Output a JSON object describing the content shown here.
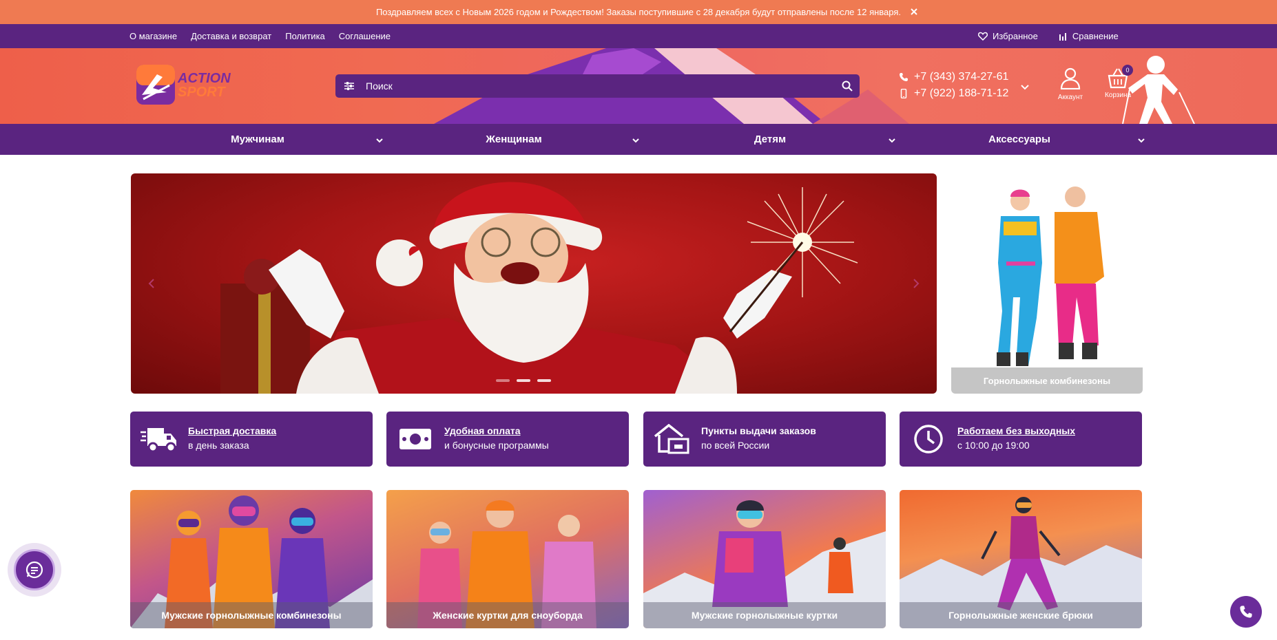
{
  "announcement": {
    "text": "Поздравляем всех с Новым 2026 годом и Рождеством! Заказы поступившие с 28 декабря будут отправлены после 12 января.",
    "close_icon": "close-icon"
  },
  "topnav": {
    "links": [
      "О магазине",
      "Доставка и возврат",
      "Политика",
      "Соглашение"
    ],
    "favorites_label": "Избранное",
    "compare_label": "Сравнение"
  },
  "header": {
    "logo_text_1": "ACTION",
    "logo_text_2": "SPORT",
    "search_placeholder": "Поиск",
    "phones": [
      "+7 (343) 374-27-61",
      "+7 (922) 188-71-12"
    ],
    "account_label": "Аккаунт",
    "cart_label": "Корзина",
    "cart_count": "0"
  },
  "categories": [
    {
      "label": "Мужчинам"
    },
    {
      "label": "Женщинам"
    },
    {
      "label": "Детям"
    },
    {
      "label": "Аксессуары"
    }
  ],
  "hero": {
    "slide_count": 3,
    "active_slide": 1
  },
  "side_banner": {
    "caption": "Горнолыжные комбинезоны"
  },
  "features": [
    {
      "title": "Быстрая доставка",
      "subtitle": "в день заказа",
      "icon": "truck-icon",
      "underlined": true
    },
    {
      "title": "Удобная оплата",
      "subtitle": "и бонусные программы",
      "icon": "cash-icon",
      "underlined": true
    },
    {
      "title": "Пункты выдачи заказов",
      "subtitle": "по всей России",
      "icon": "pickup-point-icon",
      "underlined": false
    },
    {
      "title": "Работаем без выходных",
      "subtitle": "с 10:00 до 19:00",
      "icon": "clock-icon",
      "underlined": true
    }
  ],
  "cards": [
    {
      "caption": "Мужские горнолыжные комбинезоны"
    },
    {
      "caption": "Женские куртки для сноуборда"
    },
    {
      "caption": "Мужские горнолыжные куртки"
    },
    {
      "caption": "Горнолыжные женские брюки"
    }
  ],
  "colors": {
    "brand_purple": "#5a2480",
    "announce_orange": "#ef7a52",
    "header_coral": "#ee5f4a"
  }
}
